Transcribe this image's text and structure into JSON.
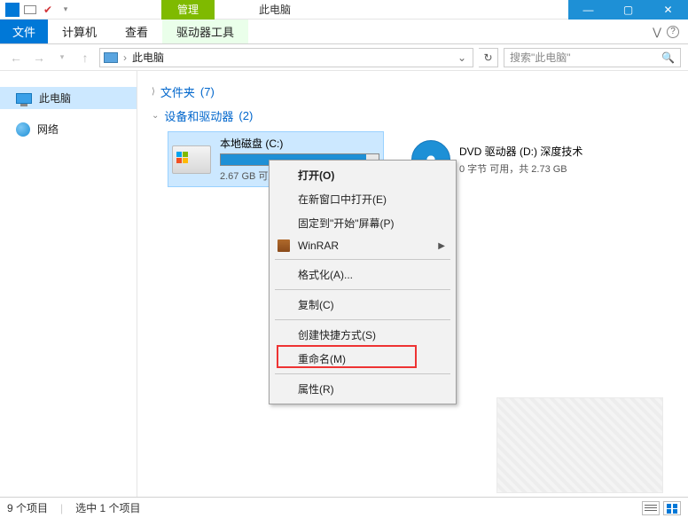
{
  "titlebar": {
    "contextual_tab": "管理",
    "window_title": "此电脑"
  },
  "ribbon": {
    "file": "文件",
    "tabs": [
      "计算机",
      "查看"
    ],
    "tools_tab": "驱动器工具"
  },
  "address": {
    "location": "此电脑",
    "separator": "›"
  },
  "search": {
    "placeholder": "搜索\"此电脑\""
  },
  "navpane": {
    "items": [
      {
        "label": "此电脑",
        "selected": true
      },
      {
        "label": "网络",
        "selected": false
      }
    ]
  },
  "groups": {
    "folders": {
      "label": "文件夹",
      "count": "(7)"
    },
    "devices": {
      "label": "设备和驱动器",
      "count": "(2)"
    }
  },
  "drives": [
    {
      "name": "本地磁盘 (C:)",
      "stats": "2.67 GB 可用",
      "fill_pct": 92,
      "selected": true,
      "kind": "hdd-win"
    },
    {
      "name": "DVD 驱动器 (D:) 深度技术",
      "stats": "0 字节 可用，共 2.73 GB",
      "fill_pct": 0,
      "selected": false,
      "kind": "dvd"
    }
  ],
  "context_menu": {
    "items": [
      {
        "label": "打开(O)",
        "bold": true
      },
      {
        "label": "在新窗口中打开(E)"
      },
      {
        "label": "固定到\"开始\"屏幕(P)"
      },
      {
        "label": "WinRAR",
        "icon": "winrar",
        "submenu": true
      },
      {
        "sep": true
      },
      {
        "label": "格式化(A)..."
      },
      {
        "sep": true
      },
      {
        "label": "复制(C)"
      },
      {
        "sep": true
      },
      {
        "label": "创建快捷方式(S)"
      },
      {
        "label": "重命名(M)"
      },
      {
        "sep": true
      },
      {
        "label": "属性(R)",
        "highlight": true
      }
    ]
  },
  "statusbar": {
    "count": "9 个项目",
    "selection": "选中 1 个项目"
  }
}
